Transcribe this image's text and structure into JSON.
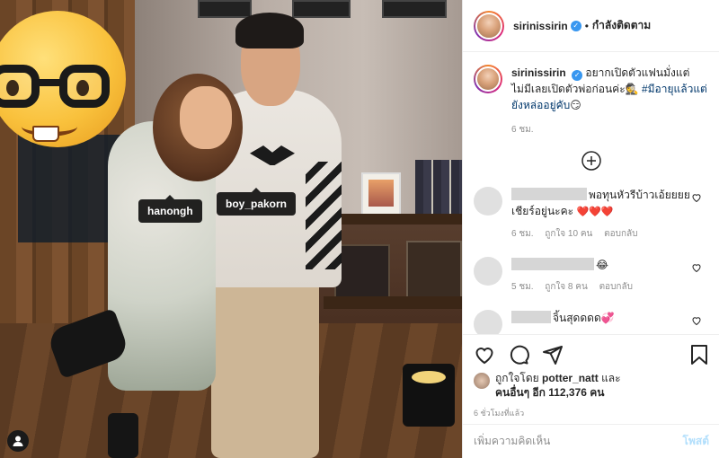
{
  "post": {
    "username": "sirinissirin",
    "follow_status": "กำลังติดตาม",
    "caption_text": "อยากเปิดตัวแฟนมั่งแต่ไม่มีเลยเปิดตัวพ่อก่อนค่ะ🕵️",
    "caption_hashtag": "#มีอายุแล้วแต่ยังหล่ออยู่คับ",
    "caption_emoji": "😏",
    "caption_time": "6 ชม.",
    "tags": [
      {
        "label": "hanongh"
      },
      {
        "label": "boy_pakorn"
      }
    ],
    "comments": [
      {
        "text": "พอทุนหัวรีบ้าวเอ้ยยยย เชียร์อยู่นะคะ",
        "hearts": "❤️❤️❤️",
        "time": "6 ชม.",
        "likes": "ถูกใจ 10 คน",
        "reply": "ตอบกลับ"
      },
      {
        "text": "",
        "emoji": "😂",
        "time": "5 ชม.",
        "likes": "ถูกใจ 8 คน",
        "reply": "ตอบกลับ"
      },
      {
        "text": "จิ้นสุดดดด",
        "emoji": "💞"
      }
    ],
    "liked_by_prefix": "ถูกใจโดย",
    "liked_by_user": "potter_natt",
    "liked_by_and": "และ",
    "liked_by_others": "คนอื่นๆ อีก 112,376 คน",
    "post_time": "6 ชั่วโมงที่แล้ว",
    "add_comment_placeholder": "เพิ่มความคิดเห็น",
    "post_button": "โพสต์"
  },
  "colors": {
    "link": "#00376b",
    "verified": "#3897f0",
    "post_disabled": "#b2dffc",
    "heart": "#e0245e"
  },
  "icons": [
    "verified-icon",
    "plus-circle-icon",
    "heart-icon",
    "comment-icon",
    "share-icon",
    "bookmark-icon",
    "user-tag-icon"
  ]
}
